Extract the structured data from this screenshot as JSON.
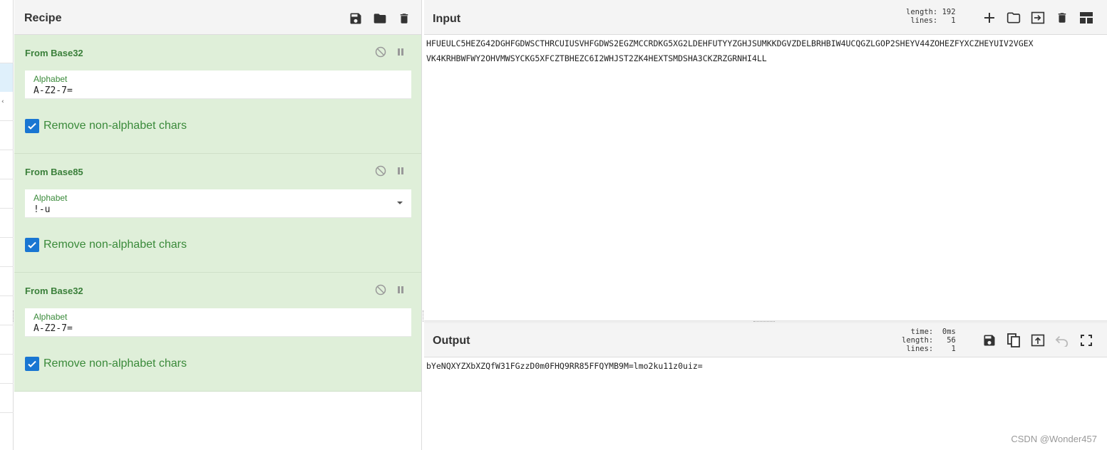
{
  "recipe": {
    "title": "Recipe",
    "operations": [
      {
        "name": "From Base32",
        "field_label": "Alphabet",
        "field_value": "A-Z2-7=",
        "has_dropdown": false,
        "checkbox_label": "Remove non-alphabet chars",
        "checked": true
      },
      {
        "name": "From Base85",
        "field_label": "Alphabet",
        "field_value": "!-u",
        "has_dropdown": true,
        "checkbox_label": "Remove non-alphabet chars",
        "checked": true
      },
      {
        "name": "From Base32",
        "field_label": "Alphabet",
        "field_value": "A-Z2-7=",
        "has_dropdown": false,
        "checkbox_label": "Remove non-alphabet chars",
        "checked": true
      }
    ]
  },
  "input": {
    "title": "Input",
    "stats": "length: 192\n lines:   1",
    "lines": [
      "HFUEULC5HEZG42DGHFGDWSCTHRCUIUSVHFGDWS2EGZMCCRDKG5XG2LDEHFUTYYZGHJSUMKKDGVZDELBRHBIW4UCQGZLGOP2SHEYV44ZOHEZFYXCZHEYUIV2VGEX",
      "VK4KRHBWFWY2OHVMWSYCKG5XFCZTBHEZC6I2WHJST2ZK4HEXTSMDSHA3CKZRZGRNHI4LL"
    ]
  },
  "output": {
    "title": "Output",
    "stats": "  time:  0ms\nlength:   56\n lines:    1",
    "text": "bYeNQXYZXbXZQfW31FGzzD0m0FHQ9RR85FFQYMB9M=lmo2ku11z0uiz="
  },
  "watermark": "CSDN @Wonder457",
  "colors": {
    "accent": "#1976d2",
    "op_bg": "#dfefd9",
    "op_title": "#3a7f3a"
  }
}
